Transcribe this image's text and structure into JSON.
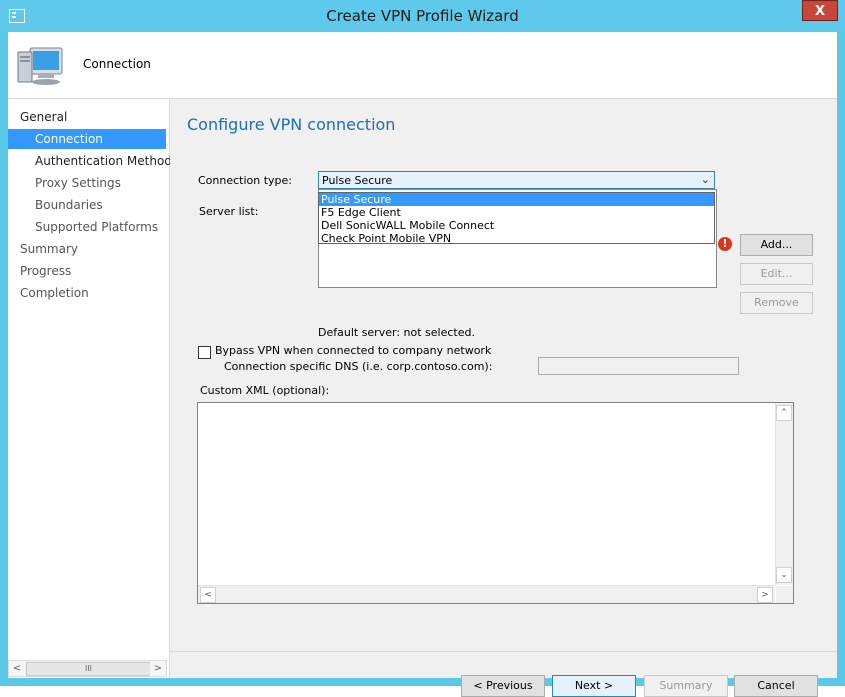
{
  "window": {
    "title": "Create VPN Profile Wizard",
    "close_symbol": "X"
  },
  "header": {
    "title": "Connection",
    "icon": "computer-monitor-icon"
  },
  "nav": {
    "items": [
      {
        "label": "General"
      },
      {
        "label": "Connection"
      },
      {
        "label": "Authentication Method"
      },
      {
        "label": "Proxy Settings"
      },
      {
        "label": "Boundaries"
      },
      {
        "label": "Supported Platforms"
      },
      {
        "label": "Summary"
      },
      {
        "label": "Progress"
      },
      {
        "label": "Completion"
      }
    ],
    "scroll_thumb_glyph": "III"
  },
  "content": {
    "title": "Configure VPN connection",
    "connection_type_label": "Connection type:",
    "connection_type_value": "Pulse Secure",
    "dropdown_options": [
      "Pulse Secure",
      "F5 Edge Client",
      "Dell SonicWALL Mobile Connect",
      "Check Point Mobile VPN"
    ],
    "server_list_label": "Server list:",
    "default_server_text": "Default server: not selected.",
    "bypass_label": "Bypass VPN when connected to company network",
    "dns_label": "Connection specific DNS (i.e. corp.contoso.com):",
    "custom_xml_label": "Custom XML (optional):",
    "buttons": {
      "add": "Add...",
      "edit": "Edit...",
      "remove": "Remove"
    },
    "error_symbol": "!"
  },
  "footer": {
    "previous": "< Previous",
    "next": "Next >",
    "summary": "Summary",
    "cancel": "Cancel"
  },
  "colors": {
    "accent": "#3399ff",
    "title_bar": "#5ec9ea",
    "heading": "#1a6fb5",
    "error": "#d9351f"
  }
}
